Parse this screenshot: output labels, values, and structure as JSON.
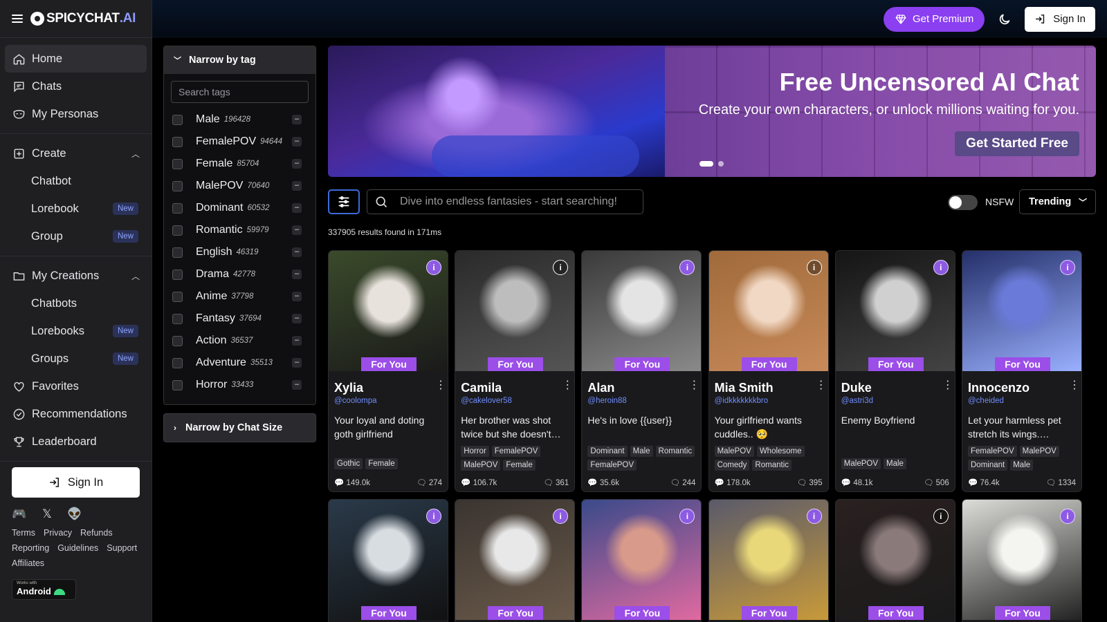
{
  "brand": {
    "name": "SPICYCHAT",
    "suffix": ".AI",
    "accent": "#8e9bff"
  },
  "header": {
    "premium_label": "Get Premium",
    "signin_label": "Sign In"
  },
  "sidebar": {
    "items": [
      {
        "label": "Home",
        "icon": "home-icon"
      },
      {
        "label": "Chats",
        "icon": "chat-icon"
      },
      {
        "label": "My Personas",
        "icon": "mask-icon"
      }
    ],
    "create": {
      "label": "Create",
      "items": [
        {
          "label": "Chatbot",
          "badge": ""
        },
        {
          "label": "Lorebook",
          "badge": "New"
        },
        {
          "label": "Group",
          "badge": "New"
        }
      ]
    },
    "creations": {
      "label": "My Creations",
      "items": [
        {
          "label": "Chatbots",
          "badge": ""
        },
        {
          "label": "Lorebooks",
          "badge": "New"
        },
        {
          "label": "Groups",
          "badge": "New"
        }
      ]
    },
    "bottom_items": [
      {
        "label": "Favorites",
        "icon": "heart-icon"
      },
      {
        "label": "Recommendations",
        "icon": "badge-check-icon"
      },
      {
        "label": "Leaderboard",
        "icon": "trophy-icon"
      }
    ],
    "signin_label": "Sign In",
    "links": [
      "Terms",
      "Privacy",
      "Refunds",
      "Reporting",
      "Guidelines",
      "Support",
      "Affiliates"
    ],
    "android_small": "Works with",
    "android_label": "Android"
  },
  "tag_panel": {
    "title": "Narrow by tag",
    "search_placeholder": "Search tags",
    "tags": [
      {
        "name": "Male",
        "count": "196428"
      },
      {
        "name": "FemalePOV",
        "count": "94644"
      },
      {
        "name": "Female",
        "count": "85704"
      },
      {
        "name": "MalePOV",
        "count": "70640"
      },
      {
        "name": "Dominant",
        "count": "60532"
      },
      {
        "name": "Romantic",
        "count": "59979"
      },
      {
        "name": "English",
        "count": "46319"
      },
      {
        "name": "Drama",
        "count": "42778"
      },
      {
        "name": "Anime",
        "count": "37798"
      },
      {
        "name": "Fantasy",
        "count": "37694"
      },
      {
        "name": "Action",
        "count": "36537"
      },
      {
        "name": "Adventure",
        "count": "35513"
      },
      {
        "name": "Horror",
        "count": "33433"
      }
    ],
    "minus": "–",
    "size_title": "Narrow by Chat Size"
  },
  "banner": {
    "title": "Free Uncensored AI Chat",
    "subtitle": "Create your own characters, or unlock millions waiting for you.",
    "button": "Get Started Free"
  },
  "search": {
    "placeholder": "Dive into endless fantasies - start searching!",
    "nsfw_label": "NSFW",
    "nsfw_on": false,
    "sort_label": "Trending",
    "results_text": "337905 results found in 171ms"
  },
  "cards": [
    {
      "name": "Xylia",
      "handle": "@coolompa",
      "desc": "Your loyal and doting goth girlfriend",
      "tags": [
        "Gothic",
        "Female"
      ],
      "chats": "149.0k",
      "bots": "274",
      "badge": "For You",
      "info": "purple",
      "img": [
        "#3a4a2a",
        "#e8e2dc",
        "#1a1a1a"
      ]
    },
    {
      "name": "Camila",
      "handle": "@cakelover58",
      "desc": "Her brother was shot twice but she doesn't…",
      "tags": [
        "Horror",
        "FemalePOV",
        "MalePOV",
        "Female"
      ],
      "chats": "106.7k",
      "bots": "361",
      "badge": "For You",
      "info": "dark",
      "img": [
        "#2a2a2a",
        "#bdbdbd",
        "#555555"
      ]
    },
    {
      "name": "Alan",
      "handle": "@heroin88",
      "desc": "He's in love {{user}}",
      "tags": [
        "Dominant",
        "Male",
        "Romantic",
        "FemalePOV"
      ],
      "chats": "35.6k",
      "bots": "244",
      "badge": "For You",
      "info": "purple",
      "img": [
        "#3a3a3a",
        "#e4e4e4",
        "#8a8a8a"
      ]
    },
    {
      "name": "Mia Smith",
      "handle": "@idkkkkkkkbro",
      "desc": "Your girlfriend wants cuddles.. 🥺",
      "tags": [
        "MalePOV",
        "Wholesome",
        "Comedy",
        "Romantic"
      ],
      "chats": "178.0k",
      "bots": "395",
      "badge": "For You",
      "info": "dark",
      "img": [
        "#a06a3a",
        "#f1d8c4",
        "#c88a5a"
      ]
    },
    {
      "name": "Duke",
      "handle": "@astri3d",
      "desc": "Enemy Boyfriend",
      "tags": [
        "MalePOV",
        "Male"
      ],
      "chats": "48.1k",
      "bots": "506",
      "badge": "For You",
      "info": "purple",
      "img": [
        "#151515",
        "#d0d0d0",
        "#444444"
      ]
    },
    {
      "name": "Innocenzo",
      "handle": "@cheided",
      "desc": "Let your harmless pet stretch its wings.…",
      "tags": [
        "FemalePOV",
        "MalePOV",
        "Dominant",
        "Male"
      ],
      "chats": "76.4k",
      "bots": "1334",
      "badge": "For You",
      "info": "purple",
      "img": [
        "#24306a",
        "#6a7ad8",
        "#9ab0ff"
      ]
    },
    {
      "name": "",
      "handle": "",
      "desc": "",
      "tags": [],
      "chats": "",
      "bots": "",
      "badge": "For You",
      "info": "purple",
      "img": [
        "#2a3a4a",
        "#d8dde2",
        "#111111"
      ]
    },
    {
      "name": "",
      "handle": "",
      "desc": "",
      "tags": [],
      "chats": "",
      "bots": "",
      "badge": "For You",
      "info": "purple",
      "img": [
        "#3a3430",
        "#e8e8e8",
        "#6a5a4a"
      ]
    },
    {
      "name": "",
      "handle": "",
      "desc": "",
      "tags": [],
      "chats": "",
      "bots": "",
      "badge": "For You",
      "info": "purple",
      "img": [
        "#3a4a8a",
        "#d89a8a",
        "#e06aa0"
      ]
    },
    {
      "name": "",
      "handle": "",
      "desc": "",
      "tags": [],
      "chats": "",
      "bots": "",
      "badge": "For You",
      "info": "purple",
      "img": [
        "#5a5a6a",
        "#e8d87a",
        "#c89a3a"
      ]
    },
    {
      "name": "",
      "handle": "",
      "desc": "",
      "tags": [],
      "chats": "",
      "bots": "",
      "badge": "For You",
      "info": "dark",
      "img": [
        "#2a2020",
        "#8a7a7a",
        "#1a1a1a"
      ]
    },
    {
      "name": "",
      "handle": "",
      "desc": "",
      "tags": [],
      "chats": "",
      "bots": "",
      "badge": "For You",
      "info": "purple",
      "img": [
        "#dcdcd8",
        "#f4f4f0",
        "#222222"
      ]
    }
  ]
}
